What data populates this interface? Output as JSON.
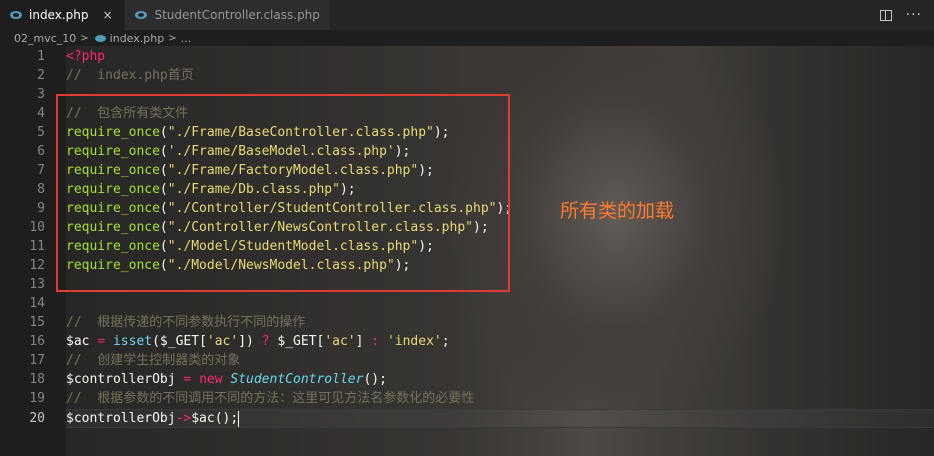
{
  "tabs": [
    {
      "label": "index.php",
      "active": true,
      "close": "×"
    },
    {
      "label": "StudentController.class.php",
      "active": false
    }
  ],
  "tab_actions": {
    "split_icon": "split-editor-icon",
    "more_icon": "more-icon",
    "more_glyph": "···"
  },
  "breadcrumb": {
    "folder": "02_mvc_10",
    "file": "index.php",
    "sep": ">",
    "tail": "..."
  },
  "editor": {
    "current_line": 20,
    "line_numbers": [
      "1",
      "2",
      "3",
      "4",
      "5",
      "6",
      "7",
      "8",
      "9",
      "10",
      "11",
      "12",
      "13",
      "14",
      "15",
      "16",
      "17",
      "18",
      "19",
      "20"
    ],
    "lines": {
      "l1": "<?php",
      "l2": "//  index.php首页",
      "l4": "//  包含所有类文件",
      "l5a": "require_once",
      "l5b": "(",
      "l5c": "\"./Frame/BaseController.class.php\"",
      "l5d": ");",
      "l6a": "require_once",
      "l6b": "(",
      "l6c": "'./Frame/BaseModel.class.php'",
      "l6d": ");",
      "l7a": "require_once",
      "l7b": "(",
      "l7c": "\"./Frame/FactoryModel.class.php\"",
      "l7d": ");",
      "l8a": "require_once",
      "l8b": "(",
      "l8c": "\"./Frame/Db.class.php\"",
      "l8d": ");",
      "l9a": "require_once",
      "l9b": "(",
      "l9c": "\"./Controller/StudentController.class.php\"",
      "l9d": ");",
      "l10a": "require_once",
      "l10b": "(",
      "l10c": "\"./Controller/NewsController.class.php\"",
      "l10d": ");",
      "l11a": "require_once",
      "l11b": "(",
      "l11c": "\"./Model/StudentModel.class.php\"",
      "l11d": ");",
      "l12a": "require_once",
      "l12b": "(",
      "l12c": "\"./Model/NewsModel.class.php\"",
      "l12d": ");",
      "l15": "//  根据传递的不同参数执行不同的操作",
      "l16a": "$ac",
      "l16b": " = ",
      "l16c": "isset",
      "l16d": "($_GET[",
      "l16e": "'ac'",
      "l16f": "]) ",
      "l16g": "?",
      "l16h": " $_GET[",
      "l16i": "'ac'",
      "l16j": "] ",
      "l16k": ":",
      "l16l": " ",
      "l16m": "'index'",
      "l16n": ";",
      "l17": "//  创建学生控制器类的对象",
      "l18a": "$controllerObj",
      "l18b": " = ",
      "l18c": "new",
      "l18d": " ",
      "l18e": "StudentController",
      "l18f": "();",
      "l19": "//  根据参数的不同调用不同的方法：这里可见方法名参数化的必要性",
      "l20a": "$controllerObj",
      "l20b": "->",
      "l20c": "$ac",
      "l20d": "();"
    }
  },
  "annotation": {
    "text": "所有类的加载",
    "color": "#ff7a2e"
  },
  "highlight_box_color": "#e03c31"
}
